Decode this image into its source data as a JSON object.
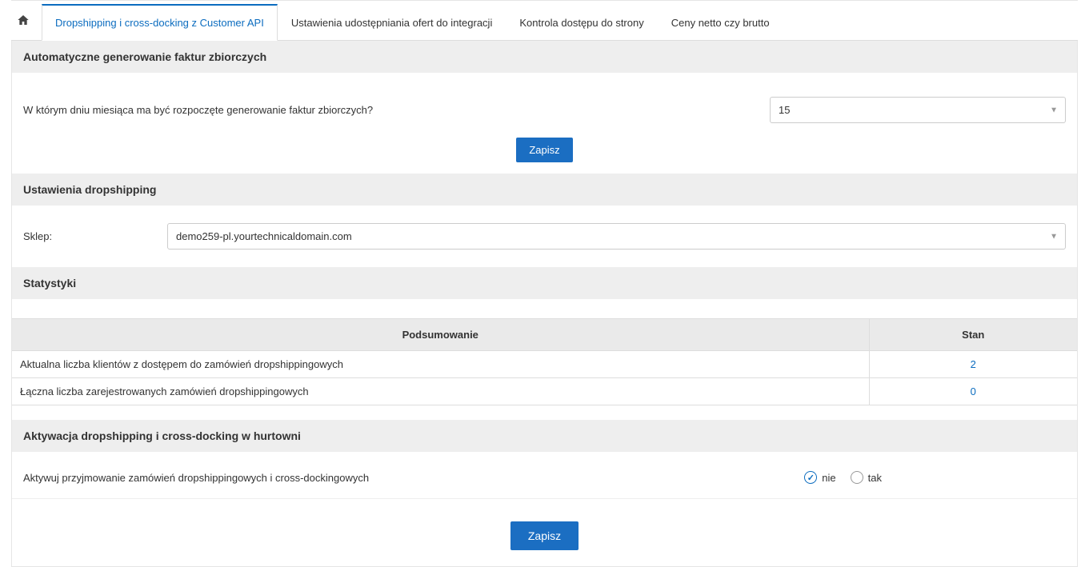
{
  "tabs": {
    "t0": "Dropshipping i cross-docking z Customer API",
    "t1": "Ustawienia udostępniania ofert do integracji",
    "t2": "Kontrola dostępu do strony",
    "t3": "Ceny netto czy brutto"
  },
  "section_auto_invoice": {
    "header": "Automatyczne generowanie faktur zbiorczych",
    "question": "W którym dniu miesiąca ma być rozpoczęte generowanie faktur zbiorczych?",
    "value": "15",
    "save": "Zapisz"
  },
  "section_dropship": {
    "header": "Ustawienia dropshipping",
    "shop_label": "Sklep:",
    "shop_value": "demo259-pl.yourtechnicaldomain.com"
  },
  "section_stats": {
    "header": "Statystyki",
    "col_summary": "Podsumowanie",
    "col_state": "Stan",
    "rows": [
      {
        "label": "Aktualna liczba klientów z dostępem do zamówień dropshippingowych",
        "value": "2"
      },
      {
        "label": "Łączna liczba zarejestrowanych zamówień dropshippingowych",
        "value": "0"
      }
    ]
  },
  "section_activation": {
    "header": "Aktywacja dropshipping i cross-docking w hurtowni",
    "label": "Aktywuj przyjmowanie zamówień dropshippingowych i cross-dockingowych",
    "option_no": "nie",
    "option_yes": "tak",
    "save": "Zapisz"
  }
}
